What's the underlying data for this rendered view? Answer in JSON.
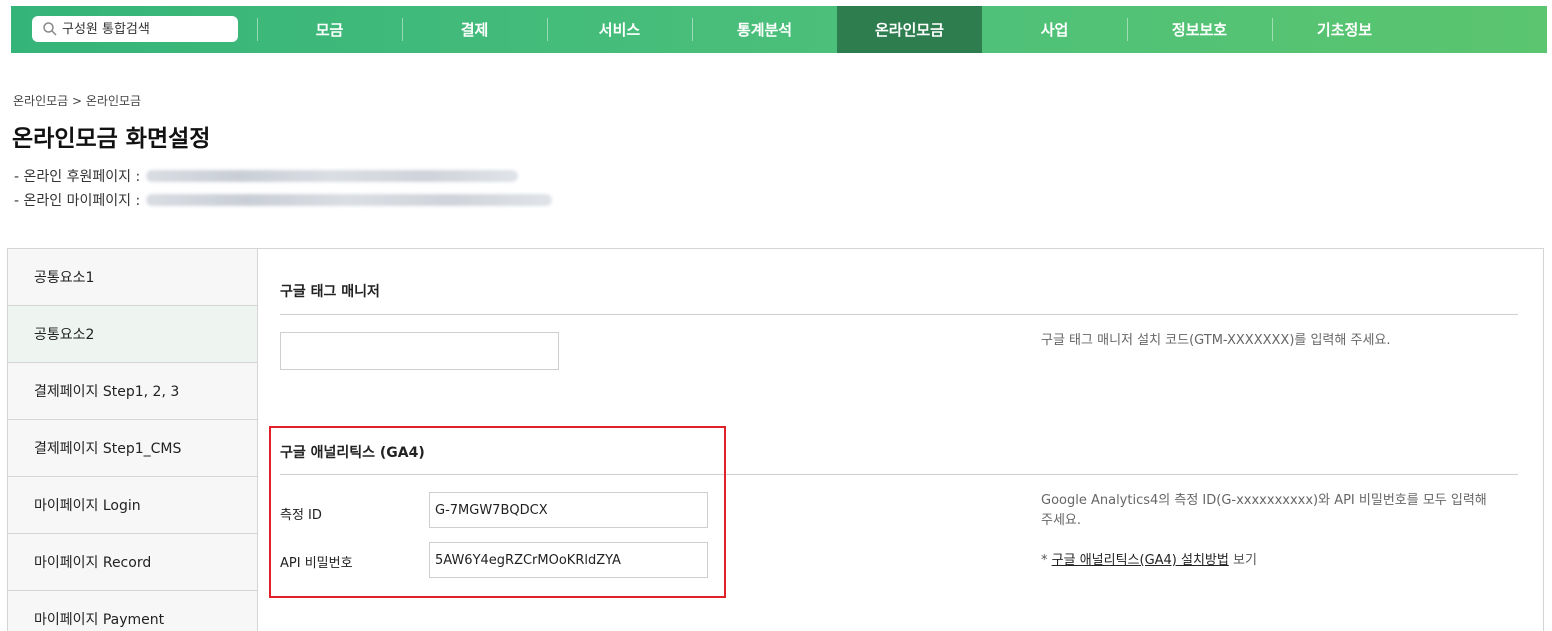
{
  "topnav": {
    "search_placeholder": "구성원 통합검색",
    "menu": [
      {
        "label": "모금"
      },
      {
        "label": "결제"
      },
      {
        "label": "서비스"
      },
      {
        "label": "통계분석"
      },
      {
        "label": "온라인모금",
        "active": true
      },
      {
        "label": "사업"
      },
      {
        "label": "정보보호"
      },
      {
        "label": "기초정보"
      }
    ],
    "colors": {
      "bar": "#4cc07a",
      "active": "#2e7d4f"
    }
  },
  "breadcrumb": "온라인모금 > 온라인모금",
  "page_title": "온라인모금 화면설정",
  "links": {
    "sponsor_label": "- 온라인 후원페이지 :",
    "mypage_label": "- 온라인 마이페이지 :"
  },
  "sidebar": {
    "items": [
      {
        "label": "공통요소1"
      },
      {
        "label": "공통요소2",
        "active": true
      },
      {
        "label": "결제페이지 Step1, 2, 3"
      },
      {
        "label": "결제페이지 Step1_CMS"
      },
      {
        "label": "마이페이지 Login"
      },
      {
        "label": "마이페이지 Record"
      },
      {
        "label": "마이페이지 Payment"
      }
    ]
  },
  "gtm": {
    "title": "구글 태그 매니저",
    "value": "",
    "help": "구글 태그 매니저 설치 코드(GTM-XXXXXXX)를 입력해 주세요."
  },
  "ga4": {
    "title": "구글 애널리틱스 (GA4)",
    "measurement_label": "측정 ID",
    "measurement_value": "G-7MGW7BQDCX",
    "api_label": "API 비밀번호",
    "api_value": "5AW6Y4egRZCrMOoKRldZYA",
    "help": "Google Analytics4의 측정 ID(G-xxxxxxxxxx)와 API 비밀번호를 모두 입력해 주세요.",
    "guide_prefix": "* ",
    "guide_link": "구글 애널리틱스(GA4) 설치방법",
    "guide_suffix": " 보기"
  },
  "highlight_color": "#e0202a"
}
